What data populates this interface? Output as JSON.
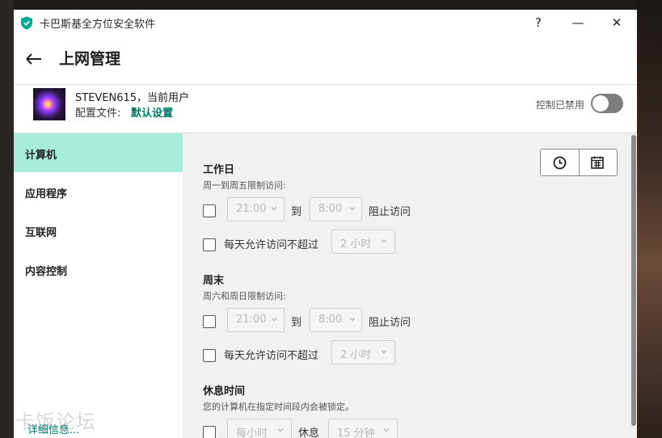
{
  "window": {
    "title": "卡巴斯基全方位安全软件",
    "help_label": "?",
    "minimize_label": "—",
    "close_label": "✕"
  },
  "header": {
    "title": "上网管理",
    "back_icon": "arrow-left-icon"
  },
  "user": {
    "name": "STEVEN615，当前用户",
    "profile_label": "配置文件:",
    "profile_value": "默认设置",
    "control_status": "控制已禁用",
    "control_enabled": false
  },
  "sidebar": {
    "items": [
      {
        "label": "计算机",
        "active": true
      },
      {
        "label": "应用程序",
        "active": false
      },
      {
        "label": "互联网",
        "active": false
      },
      {
        "label": "内容控制",
        "active": false
      }
    ],
    "more_info": "详细信息..."
  },
  "watermark": "卡饭论坛",
  "main": {
    "view_buttons": [
      "clock-icon",
      "calendar-icon"
    ],
    "weekdays": {
      "title": "工作日",
      "subtitle": "周一到周五限制访问:",
      "block_from": "21:00",
      "to_label": "到",
      "block_to": "8:00",
      "block_label": "阻止访问",
      "block_checked": false,
      "limit_label": "每天允许访问不超过",
      "limit_value": "2 小时",
      "limit_checked": false
    },
    "weekend": {
      "title": "周末",
      "subtitle": "周六和周日限制访问:",
      "block_from": "21:00",
      "to_label": "到",
      "block_to": "8:00",
      "block_label": "阻止访问",
      "block_checked": false,
      "limit_label": "每天允许访问不超过",
      "limit_value": "2 小时",
      "limit_checked": false
    },
    "breaks": {
      "title": "休息时间",
      "subtitle": "您的计算机在指定时间段内会被锁定。",
      "interval_value": "每小时",
      "rest_label": "休息",
      "duration_value": "15 分钟",
      "checked": false
    }
  },
  "colors": {
    "accent": "#007a66",
    "active_nav": "#a8eddc",
    "toggle_off": "#7d7d7d",
    "content_bg": "#f1f1f1"
  }
}
